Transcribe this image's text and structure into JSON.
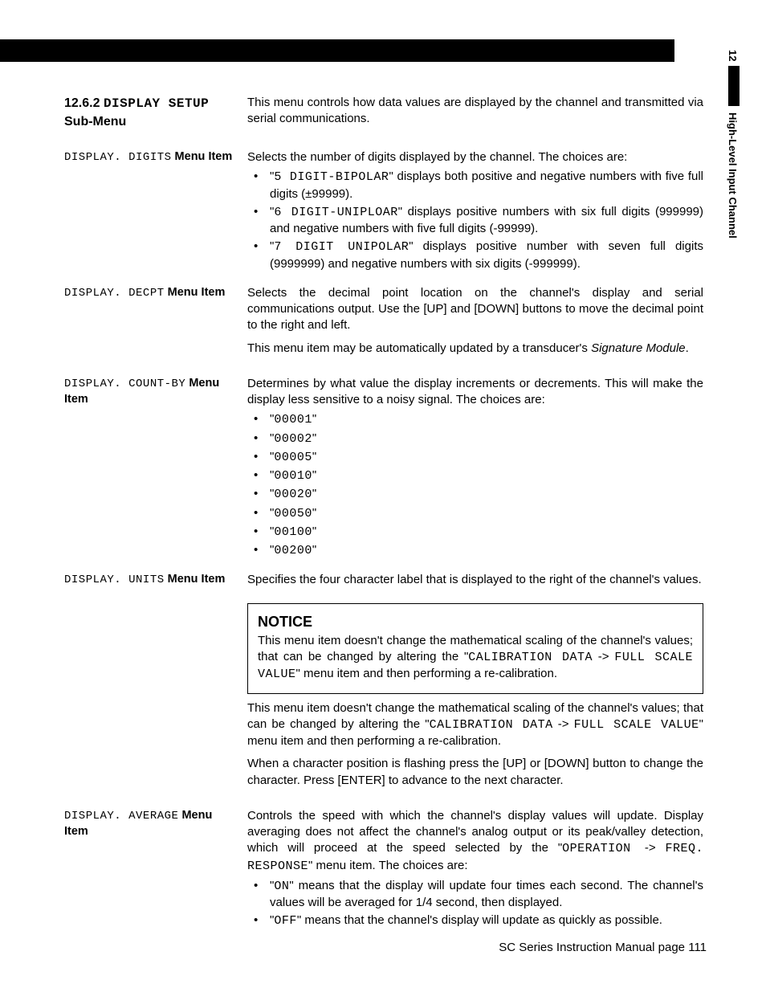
{
  "page_top_number": "12",
  "side_label": "High-Level Input Channel",
  "section": {
    "number": "12.6.2",
    "title_lcd": "DISPLAY  SETUP",
    "subtitle": "Sub-Menu",
    "intro": "This menu controls how data values are displayed by the channel and transmitted via serial communications."
  },
  "digits": {
    "label_lcd": "DISPLAY.  DIGITS",
    "label_suffix": " Menu Item",
    "intro": "Selects the number of digits displayed by the channel. The choices are:",
    "opt1_lcd": "5 DIGIT-BIPOLAR",
    "opt1_rest": "\" displays both positive and negative numbers with five full digits (±99999).",
    "opt2_lcd": "6 DIGIT-UNIPLOAR",
    "opt2_rest": "\" displays positive numbers with six full digits (999999) and negative numbers with five full digits (-99999).",
    "opt3_lcd": "7 DIGIT UNIPOLAR",
    "opt3_rest": "\" displays positive number with seven full digits (9999999) and negative numbers with six digits (-999999)."
  },
  "decpt": {
    "label_lcd": "DISPLAY.  DECPT",
    "label_suffix": " Menu Item",
    "p1": "Selects the decimal point location on the channel's display and serial communications output.  Use the [UP] and [DOWN] buttons to move the decimal point to the right and left.",
    "p2a": "This menu item may be automatically updated by a transducer's ",
    "p2b_em": "Signature Module",
    "p2c": "."
  },
  "countby": {
    "label_lcd": "DISPLAY.  COUNT-BY",
    "label_suffix": " Menu Item",
    "intro": "Determines by what value the display increments or decrements.  This will make the display less sensitive to a noisy signal. The choices are:",
    "opts": [
      "00001",
      "00002",
      "00005",
      "00010",
      "00020",
      "00050",
      "00100",
      "00200"
    ]
  },
  "units": {
    "label_lcd": "DISPLAY.  UNITS",
    "label_suffix": " Menu Item",
    "p1": "Specifies the four character label that is displayed to the right of the channel's values.",
    "notice_title": "NOTICE",
    "notice_a": "This menu item doesn't change the mathematical scaling of the channel's values; that can be changed by altering the \"",
    "notice_lcd1": "CALIBRATION DATA",
    "notice_mid": " -> ",
    "notice_lcd2": "FULL SCALE VALUE",
    "notice_b": "\" menu item and then performing a re-calibration.",
    "p2a": "This menu item doesn't change the mathematical scaling of the channel's values; that can be changed by altering the \"",
    "p2_lcd1": "CALIBRATION DATA",
    "p2_mid": " -> ",
    "p2_lcd2": "FULL SCALE VALUE",
    "p2b": "\" menu item and then performing a re-calibration.",
    "p3": "When a character position is flashing press the [UP] or [DOWN] button to change the character.  Press [ENTER] to advance to the next character."
  },
  "average": {
    "label_lcd": "DISPLAY.  AVERAGE",
    "label_suffix": " Menu Item",
    "intro_a": "Controls the speed with which the channel's display values will update.  Display averaging does not affect the channel's analog output or its peak/valley detection, which will proceed at the speed selected by the \"",
    "intro_lcd1": "OPERATION ",
    "intro_mid": " -> ",
    "intro_lcd2": "FREQ.  RESPONSE",
    "intro_b": "\" menu item.  The choices are:",
    "opt1_lcd": "ON",
    "opt1_rest": "\" means that the display will update four times each second.  The channel's values will be averaged for 1/4 second, then displayed.",
    "opt2_lcd": "OFF",
    "opt2_rest": "\" means that the channel's display will update as quickly as possible."
  },
  "footer": {
    "text": "SC Series Instruction Manual     page 111"
  }
}
